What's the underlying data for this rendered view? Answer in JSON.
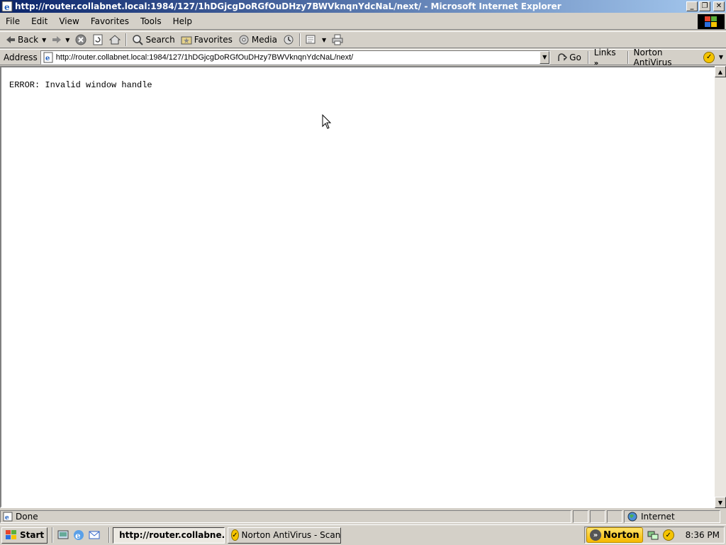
{
  "window": {
    "title": "http://router.collabnet.local:1984/127/1hDGjcgDoRGfOuDHzy7BWVknqnYdcNaL/next/ - Microsoft Internet Explorer",
    "minimize": "_",
    "restore": "❐",
    "close": "✕"
  },
  "menu": [
    "File",
    "Edit",
    "View",
    "Favorites",
    "Tools",
    "Help"
  ],
  "toolbar": {
    "back": "Back",
    "search": "Search",
    "favorites": "Favorites",
    "media": "Media"
  },
  "address": {
    "label": "Address",
    "url": "http://router.collabnet.local:1984/127/1hDGjcgDoRGfOuDHzy7BWVknqnYdcNaL/next/",
    "go": "Go",
    "links": "Links",
    "norton": "Norton AntiVirus"
  },
  "page": {
    "error": "ERROR: Invalid window handle"
  },
  "status": {
    "text": "Done",
    "zone": "Internet"
  },
  "taskbar": {
    "start": "Start",
    "tasks": [
      {
        "label": "http://router.collabne..."
      },
      {
        "label": "Norton AntiVirus - Scan"
      }
    ],
    "norton_tray": "Norton",
    "clock": "8:36 PM"
  },
  "colors": {
    "titlebar_start": "#0a246a",
    "titlebar_end": "#a6caf0",
    "chrome": "#d4d0c8",
    "norton_yellow": "#f5c400"
  }
}
